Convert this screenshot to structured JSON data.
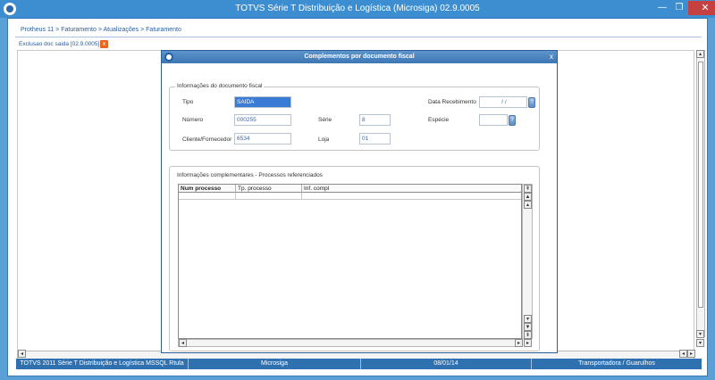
{
  "window": {
    "title": "TOTVS Série T Distribuição e Logística (Microsiga) 02.9.0005",
    "minimize_glyph": "—",
    "restore_glyph": "❐",
    "close_glyph": "✕"
  },
  "breadcrumb": "Protheus 11 > Faturamento > Atualizações > Faturamento",
  "tab": {
    "label": "Exclusao doc saida [02.9.0005]",
    "close_glyph": "x"
  },
  "dialog": {
    "title": "Complementos por documento fiscal",
    "close_glyph": "x",
    "fiscal_group": {
      "legend": "Informações do documento fiscal",
      "tipo": {
        "label": "Tipo",
        "value": "SAIDA"
      },
      "numero": {
        "label": "Número",
        "value": "000255"
      },
      "serie": {
        "label": "Série",
        "value": "8"
      },
      "cliente": {
        "label": "Cliente/Fornecedor",
        "value": "6534"
      },
      "loja": {
        "label": "Loja",
        "value": "01"
      },
      "data_recebimento": {
        "label": "Data Recebimento",
        "value": "/  /"
      },
      "especie": {
        "label": "Espécie",
        "value": ""
      }
    },
    "process_group": {
      "legend": "Informações complementares - Processos referenciados",
      "columns": [
        "Num processo",
        "Tp. processo",
        "Inf. compl"
      ]
    }
  },
  "statusbar": {
    "product": "TOTVS 2011 Série T Distribuição e Logística MSSQL Rtula",
    "system": "Microsiga",
    "date": "08/01/14",
    "branch": "Transportadora / Guarulhos"
  },
  "colors": {
    "titlebar": "#3d8ed0",
    "statusbar": "#2f71b0",
    "selection": "#3a7bd5"
  }
}
